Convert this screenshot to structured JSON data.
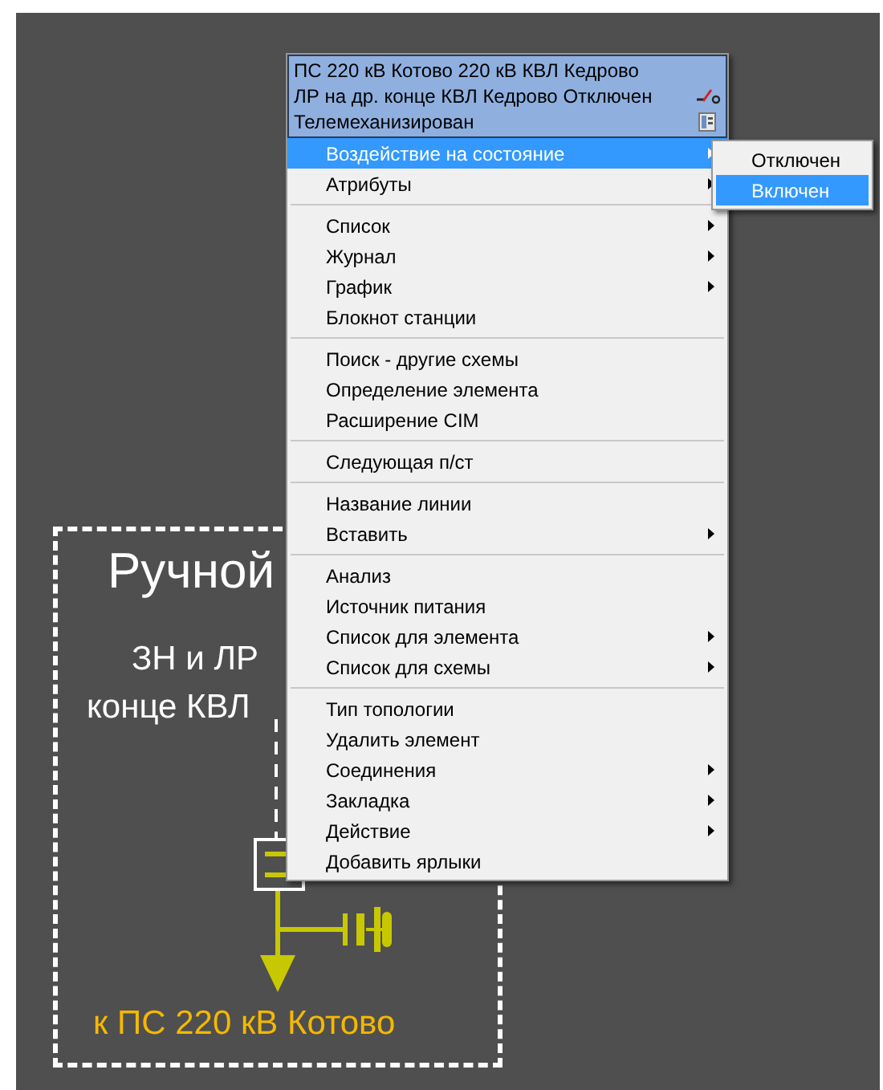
{
  "canvas": {
    "title": "Ручной",
    "subtitle_lines": [
      "ЗН и ЛР",
      "конце КВЛ"
    ],
    "destination_label": "к ПС 220 кВ Котово"
  },
  "context_menu": {
    "header_lines": [
      "ПС 220 кВ Котово 220 кВ КВЛ Кедрово",
      "ЛР на др. конце КВЛ Кедрово Отключен",
      "Телемеханизирован"
    ],
    "items": [
      {
        "kind": "item",
        "label": "Воздействие на состояние",
        "submenu": true,
        "selected": true
      },
      {
        "kind": "item",
        "label": "Атрибуты",
        "submenu": true,
        "selected": false
      },
      {
        "kind": "separator"
      },
      {
        "kind": "item",
        "label": "Список",
        "submenu": true,
        "selected": false
      },
      {
        "kind": "item",
        "label": "Журнал",
        "submenu": true,
        "selected": false
      },
      {
        "kind": "item",
        "label": "График",
        "submenu": true,
        "selected": false
      },
      {
        "kind": "item",
        "label": "Блокнот станции",
        "submenu": false,
        "selected": false
      },
      {
        "kind": "separator"
      },
      {
        "kind": "item",
        "label": "Поиск - другие схемы",
        "submenu": false,
        "selected": false
      },
      {
        "kind": "item",
        "label": "Определение элемента",
        "submenu": false,
        "selected": false
      },
      {
        "kind": "item",
        "label": "Расширение CIM",
        "submenu": false,
        "selected": false
      },
      {
        "kind": "separator"
      },
      {
        "kind": "item",
        "label": "Следующая п/ст",
        "submenu": false,
        "selected": false
      },
      {
        "kind": "separator"
      },
      {
        "kind": "item",
        "label": "Название линии",
        "submenu": false,
        "selected": false
      },
      {
        "kind": "item",
        "label": "Вставить",
        "submenu": true,
        "selected": false
      },
      {
        "kind": "separator"
      },
      {
        "kind": "item",
        "label": "Анализ",
        "submenu": false,
        "selected": false
      },
      {
        "kind": "item",
        "label": "Источник питания",
        "submenu": false,
        "selected": false
      },
      {
        "kind": "item",
        "label": "Список для элемента",
        "submenu": true,
        "selected": false
      },
      {
        "kind": "item",
        "label": "Список для схемы",
        "submenu": true,
        "selected": false
      },
      {
        "kind": "separator"
      },
      {
        "kind": "item",
        "label": "Тип топологии",
        "submenu": false,
        "selected": false
      },
      {
        "kind": "item",
        "label": "Удалить элемент",
        "submenu": false,
        "selected": false
      },
      {
        "kind": "item",
        "label": "Соединения",
        "submenu": true,
        "selected": false
      },
      {
        "kind": "item",
        "label": "Закладка",
        "submenu": true,
        "selected": false
      },
      {
        "kind": "item",
        "label": "Действие",
        "submenu": true,
        "selected": false
      },
      {
        "kind": "item",
        "label": "Добавить ярлыки",
        "submenu": false,
        "selected": false
      }
    ]
  },
  "submenu": {
    "items": [
      {
        "label": "Отключен",
        "selected": false
      },
      {
        "label": "Включен",
        "selected": true
      }
    ]
  }
}
